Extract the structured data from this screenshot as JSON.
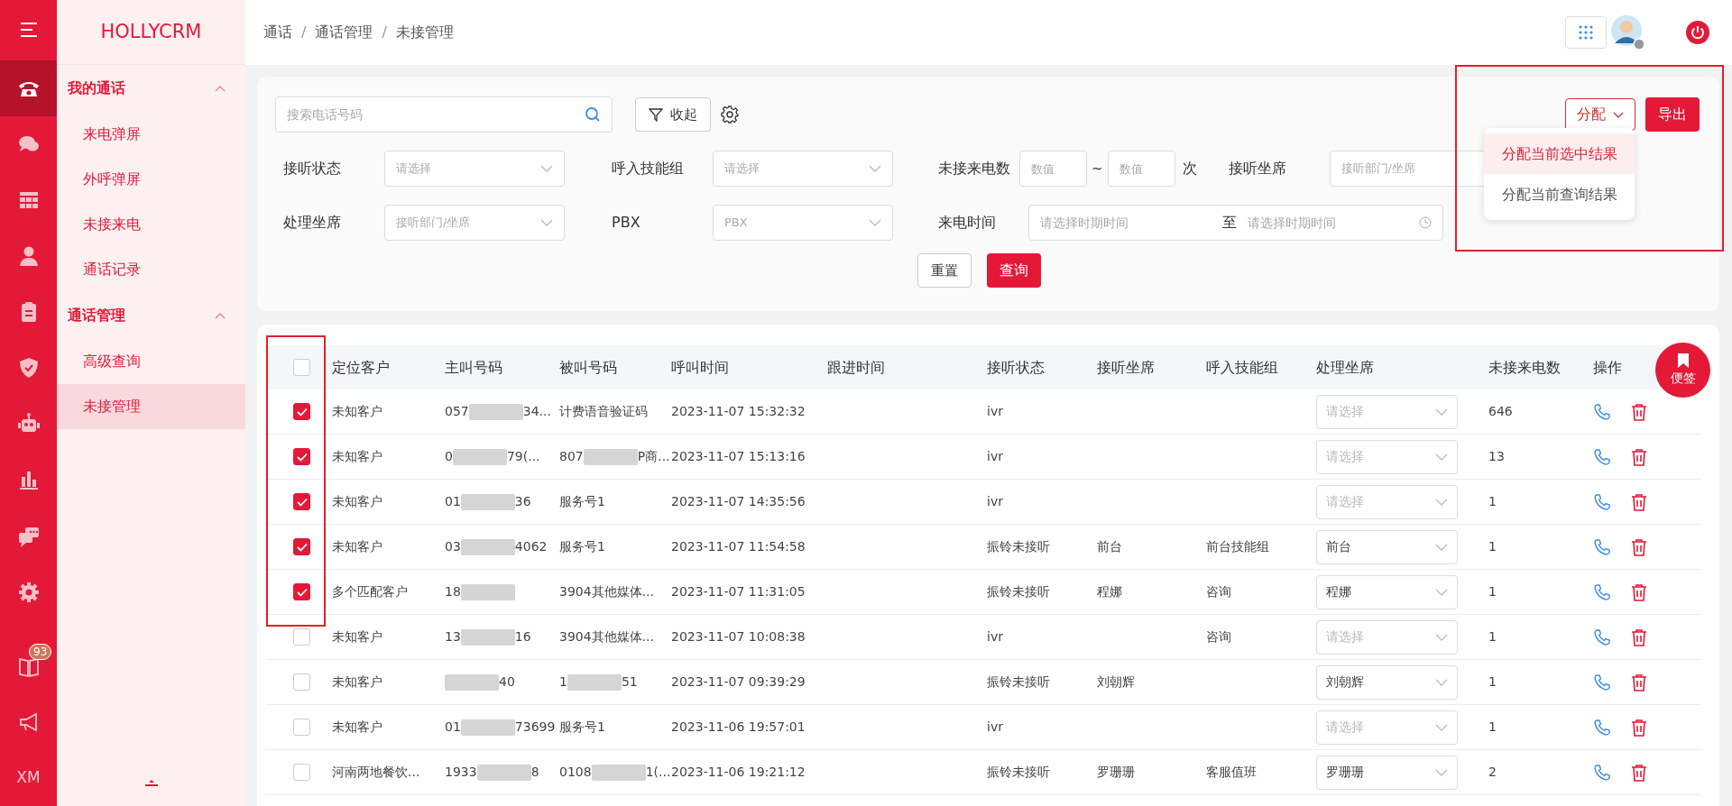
{
  "rail": {
    "items": [
      {
        "kind": "menu",
        "selected": false
      },
      {
        "kind": "phone",
        "selected": true
      },
      {
        "kind": "chat",
        "selected": false
      },
      {
        "kind": "grid",
        "selected": false
      },
      {
        "kind": "person",
        "selected": false
      },
      {
        "kind": "clipboard",
        "selected": false
      },
      {
        "kind": "shield",
        "selected": false
      },
      {
        "kind": "robot",
        "selected": false
      },
      {
        "kind": "chart",
        "selected": false
      },
      {
        "kind": "bubbles",
        "selected": false
      },
      {
        "kind": "gear",
        "selected": false
      },
      {
        "kind": "book",
        "selected": false,
        "badge": "93"
      },
      {
        "kind": "megaphone",
        "selected": false
      },
      {
        "kind": "text",
        "label": "XM",
        "selected": false
      }
    ]
  },
  "sidebar": {
    "brand": "HOLLYCRM",
    "groups": [
      {
        "label": "我的通话",
        "expanded": true,
        "items": [
          {
            "label": "来电弹屏",
            "selected": false
          },
          {
            "label": "外呼弹屏",
            "selected": false
          },
          {
            "label": "未接来电",
            "selected": false
          },
          {
            "label": "通话记录",
            "selected": false
          }
        ]
      },
      {
        "label": "通话管理",
        "expanded": true,
        "items": [
          {
            "label": "高级查询",
            "selected": false
          },
          {
            "label": "未接管理",
            "selected": true
          }
        ]
      }
    ]
  },
  "breadcrumb": {
    "items": [
      "通话",
      "通话管理",
      "未接管理"
    ],
    "separators": [
      "/",
      "/"
    ]
  },
  "filters": {
    "search": {
      "placeholder": "搜索电话号码"
    },
    "collapse_button": "收起",
    "assign_button": "分配",
    "export_button": "导出",
    "actions_highlighted": true,
    "assign_menu": [
      {
        "label": "分配当前选中结果",
        "selected": true
      },
      {
        "label": "分配当前查询结果",
        "selected": false
      }
    ],
    "status": {
      "label": "接听状态",
      "placeholder": "请选择"
    },
    "skill_group": {
      "label": "呼入技能组",
      "placeholder": "请选择"
    },
    "missed_count": {
      "label": "未接来电数",
      "min_placeholder": "数值",
      "separator": "~",
      "max_placeholder": "数值",
      "unit": "次"
    },
    "answer_agent": {
      "label": "接听坐席",
      "placeholder": "接听部门/坐席"
    },
    "handler": {
      "label": "处理坐席",
      "placeholder": "接听部门/坐席"
    },
    "pbx": {
      "label": "PBX",
      "placeholder": "PBX"
    },
    "call_time": {
      "label": "来电时间",
      "start_placeholder": "请选择时期时间",
      "separator": "至",
      "end_placeholder": "请选择时期时间"
    },
    "reset_button": "重置",
    "query_button": "查询"
  },
  "table": {
    "select_column_highlighted": true,
    "all_checked": false,
    "columns": [
      "定位客户",
      "主叫号码",
      "被叫号码",
      "呼叫时间",
      "跟进时间",
      "接听状态",
      "接听坐席",
      "呼入技能组",
      "处理坐席",
      "未接来电数",
      "操作"
    ],
    "rows": [
      {
        "checked": true,
        "customer": "未知客户",
        "caller": [
          {
            "text": "057"
          },
          {
            "kind": "blur"
          },
          {
            "text": "34..."
          }
        ],
        "callee": [
          {
            "text": "计费语音验证码"
          }
        ],
        "time": "2023-11-07 15:32:32",
        "status": "ivr",
        "handler": {
          "placeholder": "请选择"
        },
        "count": "646"
      },
      {
        "checked": true,
        "customer": "未知客户",
        "caller": [
          {
            "text": "0"
          },
          {
            "kind": "blur"
          },
          {
            "text": "79(..."
          }
        ],
        "callee": [
          {
            "text": "807"
          },
          {
            "kind": "blur"
          },
          {
            "text": "P商..."
          }
        ],
        "time": "2023-11-07 15:13:16",
        "status": "ivr",
        "handler": {
          "placeholder": "请选择"
        },
        "count": "13"
      },
      {
        "checked": true,
        "customer": "未知客户",
        "caller": [
          {
            "text": "01"
          },
          {
            "kind": "blur"
          },
          {
            "text": "36"
          }
        ],
        "callee": [
          {
            "text": "服务号1"
          }
        ],
        "time": "2023-11-07 14:35:56",
        "status": "ivr",
        "handler": {
          "placeholder": "请选择"
        },
        "count": "1"
      },
      {
        "checked": true,
        "customer": "未知客户",
        "caller": [
          {
            "text": "03"
          },
          {
            "kind": "blur"
          },
          {
            "text": "4062"
          }
        ],
        "callee": [
          {
            "text": "服务号1"
          }
        ],
        "time": "2023-11-07 11:54:58",
        "status": "振铃未接听",
        "agent": "前台",
        "group": "前台技能组",
        "handler": {
          "value": "前台"
        },
        "count": "1"
      },
      {
        "checked": true,
        "customer": "多个匹配客户",
        "caller": [
          {
            "text": "18"
          },
          {
            "kind": "blur"
          }
        ],
        "callee": [
          {
            "text": "3904其他媒体..."
          }
        ],
        "time": "2023-11-07 11:31:05",
        "status": "振铃未接听",
        "agent": "程娜",
        "group": "咨询",
        "handler": {
          "value": "程娜"
        },
        "count": "1"
      },
      {
        "checked": false,
        "customer": "未知客户",
        "caller": [
          {
            "text": "13"
          },
          {
            "kind": "blur"
          },
          {
            "text": "16"
          }
        ],
        "callee": [
          {
            "text": "3904其他媒体..."
          }
        ],
        "time": "2023-11-07 10:08:38",
        "status": "ivr",
        "group": "咨询",
        "handler": {
          "placeholder": "请选择"
        },
        "count": "1"
      },
      {
        "checked": false,
        "customer": "未知客户",
        "caller": [
          {
            "kind": "blur"
          },
          {
            "text": "40"
          }
        ],
        "callee": [
          {
            "text": "1"
          },
          {
            "kind": "blur"
          },
          {
            "text": "51"
          }
        ],
        "time": "2023-11-07 09:39:29",
        "status": "振铃未接听",
        "agent": "刘朝辉",
        "handler": {
          "value": "刘朝辉"
        },
        "count": "1"
      },
      {
        "checked": false,
        "customer": "未知客户",
        "caller": [
          {
            "text": "01"
          },
          {
            "kind": "blur"
          },
          {
            "text": "73699"
          }
        ],
        "callee": [
          {
            "text": "服务号1"
          }
        ],
        "time": "2023-11-06 19:57:01",
        "status": "ivr",
        "handler": {
          "placeholder": "请选择"
        },
        "count": "1"
      },
      {
        "checked": false,
        "customer": "河南两地餐饮...",
        "caller": [
          {
            "text": "1933"
          },
          {
            "kind": "blur"
          },
          {
            "text": "8"
          }
        ],
        "callee": [
          {
            "text": "0108"
          },
          {
            "kind": "blur"
          },
          {
            "text": "1(..."
          }
        ],
        "time": "2023-11-06 19:21:12",
        "status": "振铃未接听",
        "agent": "罗珊珊",
        "group": "客服值班",
        "handler": {
          "value": "罗珊珊"
        },
        "count": "2"
      }
    ]
  },
  "note_button": "便签"
}
